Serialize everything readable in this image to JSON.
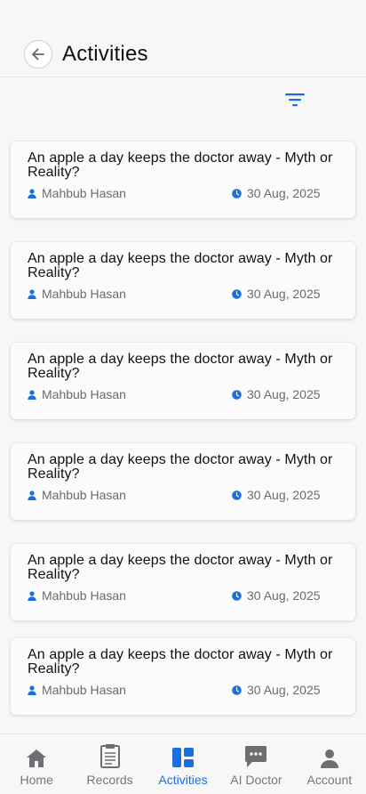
{
  "header": {
    "title": "Activities"
  },
  "colors": {
    "accent": "#1a6fe0",
    "muted": "#777777",
    "icon_grey": "#6e6e73"
  },
  "activities": [
    {
      "title": "An apple a day keeps the doctor away - Myth or Reality?",
      "author": "Mahbub Hasan",
      "date": "30 Aug, 2025"
    },
    {
      "title": "An apple a day keeps the doctor away - Myth or Reality?",
      "author": "Mahbub Hasan",
      "date": "30 Aug, 2025"
    },
    {
      "title": "An apple a day keeps the doctor away - Myth or Reality?",
      "author": "Mahbub Hasan",
      "date": "30 Aug, 2025"
    },
    {
      "title": "An apple a day keeps the doctor away - Myth or Reality?",
      "author": "Mahbub Hasan",
      "date": "30 Aug, 2025"
    },
    {
      "title": "An apple a day keeps the doctor away - Myth or Reality?",
      "author": "Mahbub Hasan",
      "date": "30 Aug, 2025"
    },
    {
      "title": "An apple a day keeps the doctor away - Myth or Reality?",
      "author": "Mahbub Hasan",
      "date": "30 Aug, 2025"
    }
  ],
  "nav": [
    {
      "label": "Home",
      "icon": "home-icon"
    },
    {
      "label": "Records",
      "icon": "records-icon"
    },
    {
      "label": "Activities",
      "icon": "activities-icon",
      "active": true
    },
    {
      "label": "AI Doctor",
      "icon": "chat-icon"
    },
    {
      "label": "Account",
      "icon": "account-icon"
    }
  ]
}
